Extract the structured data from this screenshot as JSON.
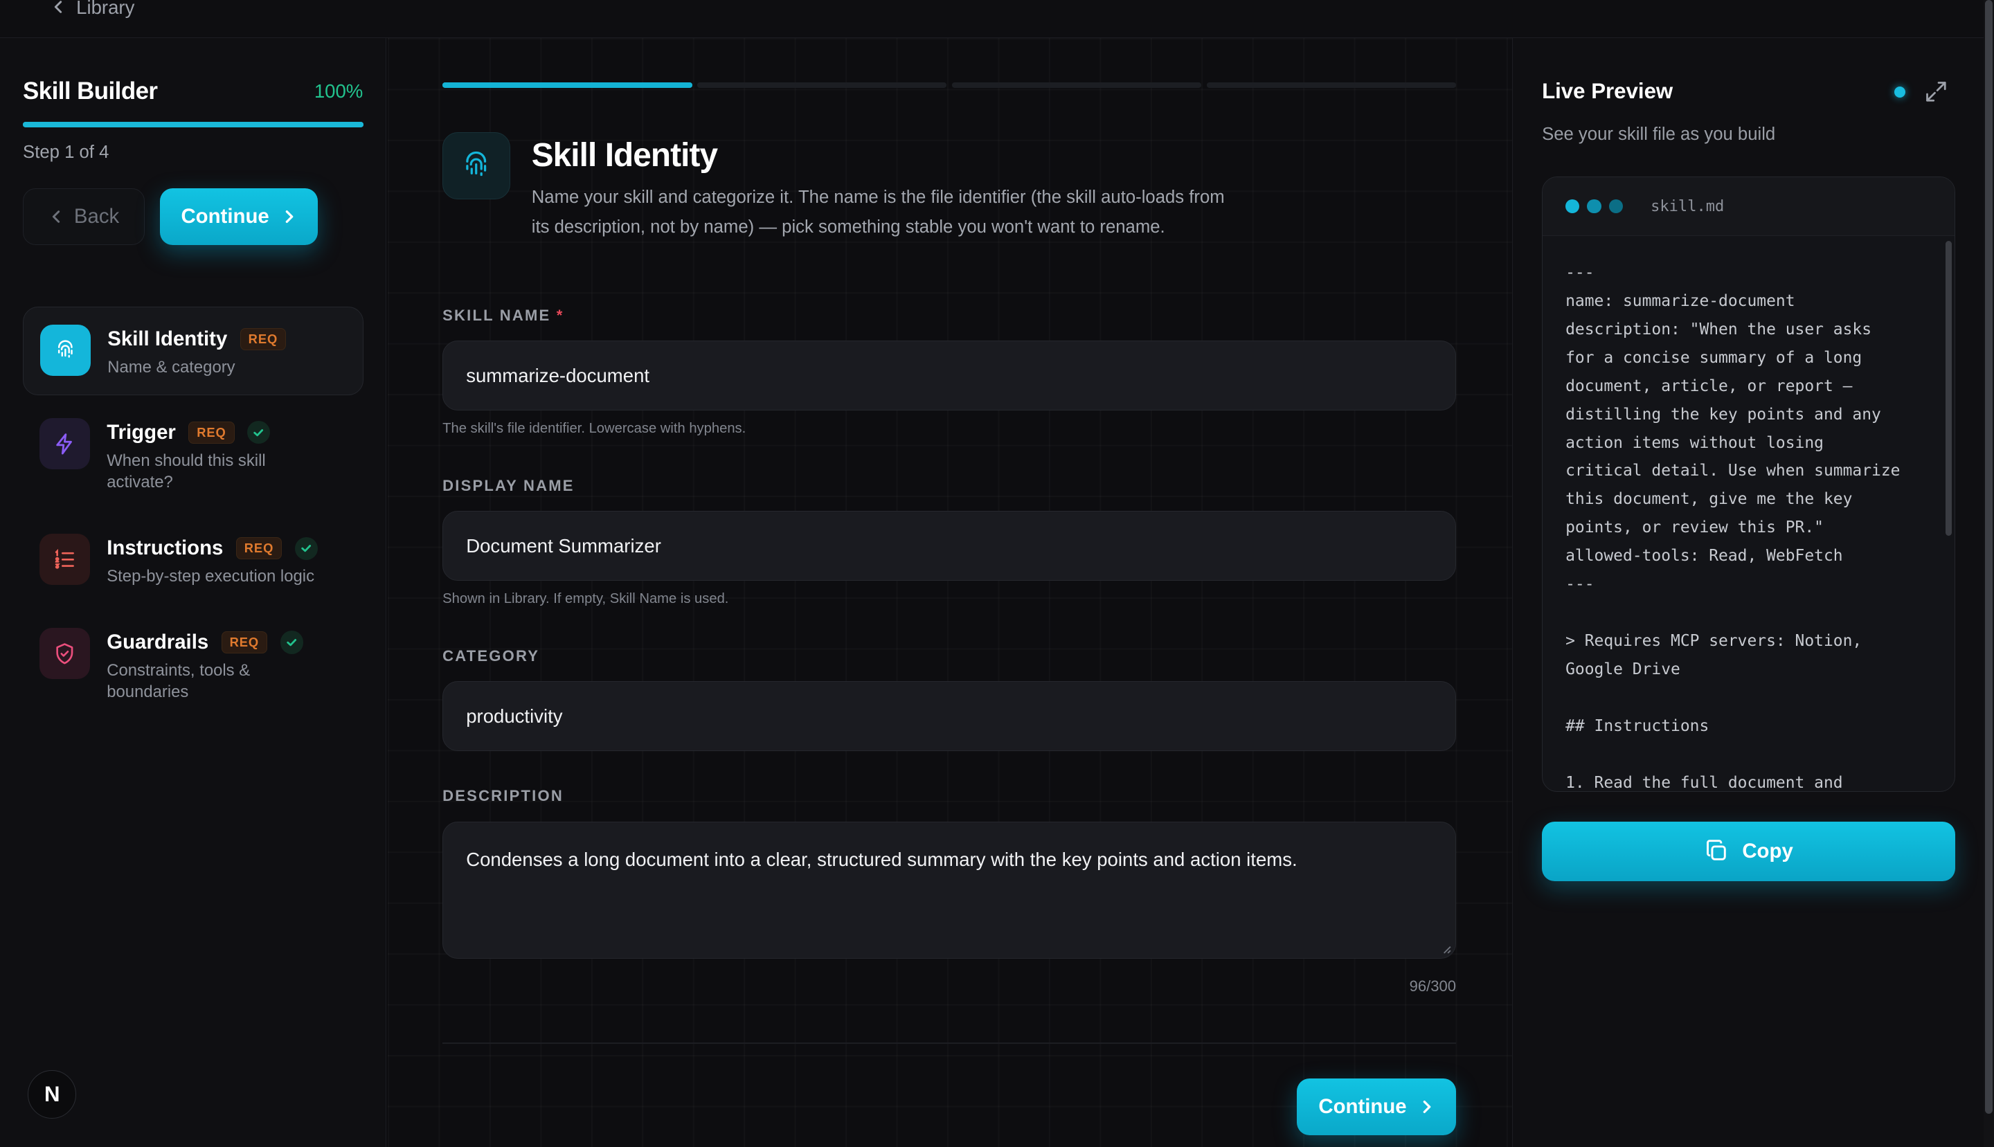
{
  "topbar": {
    "back_label": "Library"
  },
  "sidebar": {
    "title": "Skill Builder",
    "progress_pct": "100%",
    "progress_fraction": 1.0,
    "step_text": "Step 1 of 4",
    "back_label": "Back",
    "continue_label": "Continue",
    "steps": [
      {
        "name": "Skill Identity",
        "req": "REQ",
        "sub": "Name & category",
        "icon": "fingerprint-icon",
        "color": "#14b6da",
        "active": true,
        "done": false
      },
      {
        "name": "Trigger",
        "req": "REQ",
        "sub": "When should this skill activate?",
        "icon": "lightning-icon",
        "color": "#8b5cf6",
        "active": false,
        "done": true
      },
      {
        "name": "Instructions",
        "req": "REQ",
        "sub": "Step-by-step execution logic",
        "icon": "numbered-list-icon",
        "color": "#f0645a",
        "active": false,
        "done": true
      },
      {
        "name": "Guardrails",
        "req": "REQ",
        "sub": "Constraints, tools & boundaries",
        "icon": "shield-icon",
        "color": "#ec4f7d",
        "active": false,
        "done": true
      }
    ],
    "avatar_letter": "N"
  },
  "main": {
    "segments": [
      true,
      false,
      false,
      false
    ],
    "title": "Skill Identity",
    "description": "Name your skill and categorize it. The name is the file identifier (the skill auto-loads from its description, not by name) — pick something stable you won't want to rename.",
    "fields": {
      "skill_name": {
        "label": "SKILL NAME",
        "required_mark": "*",
        "value": "summarize-document",
        "help": "The skill's file identifier. Lowercase with hyphens."
      },
      "display_name": {
        "label": "DISPLAY NAME",
        "value": "Document Summarizer",
        "help": "Shown in Library. If empty, Skill Name is used."
      },
      "category": {
        "label": "CATEGORY",
        "value": "productivity"
      },
      "description": {
        "label": "DESCRIPTION",
        "value": "Condenses a long document into a clear, structured summary with the key points and action items.",
        "counter": "96/300"
      }
    },
    "continue_label": "Continue"
  },
  "preview": {
    "title": "Live Preview",
    "subtitle": "See your skill file as you build",
    "filename": "skill.md",
    "code": "---\nname: summarize-document\ndescription: \"When the user asks\nfor a concise summary of a long\ndocument, article, or report —\ndistilling the key points and any\naction items without losing\ncritical detail. Use when summarize\nthis document, give me the key\npoints, or review this PR.\"\nallowed-tools: Read, WebFetch\n---\n\n> Requires MCP servers: Notion,\nGoogle Drive\n\n## Instructions\n\n1. Read the full document and",
    "copy_label": "Copy",
    "accent": "#14b6da"
  }
}
